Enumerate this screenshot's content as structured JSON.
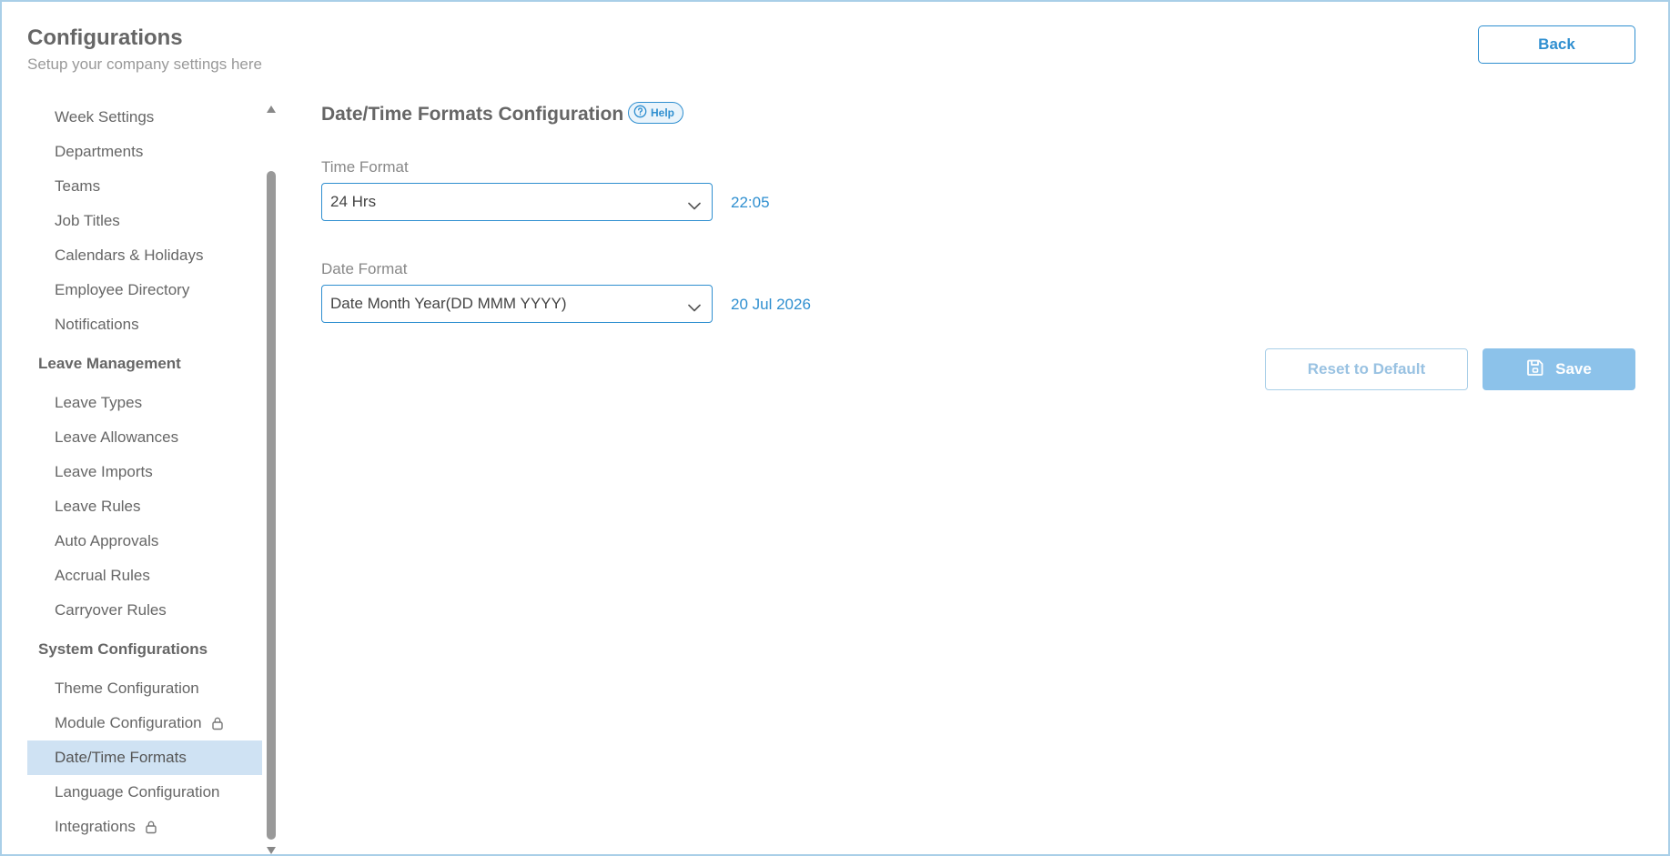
{
  "header": {
    "title": "Configurations",
    "subtitle": "Setup your company settings here",
    "back_label": "Back"
  },
  "sidebar": {
    "groups": [
      {
        "heading": "",
        "items": [
          {
            "label": "Week Settings",
            "locked": false,
            "active": false
          },
          {
            "label": "Departments",
            "locked": false,
            "active": false
          },
          {
            "label": "Teams",
            "locked": false,
            "active": false
          },
          {
            "label": "Job Titles",
            "locked": false,
            "active": false
          },
          {
            "label": "Calendars & Holidays",
            "locked": false,
            "active": false
          },
          {
            "label": "Employee Directory",
            "locked": false,
            "active": false
          },
          {
            "label": "Notifications",
            "locked": false,
            "active": false
          }
        ]
      },
      {
        "heading": "Leave Management",
        "items": [
          {
            "label": "Leave Types",
            "locked": false,
            "active": false
          },
          {
            "label": "Leave Allowances",
            "locked": false,
            "active": false
          },
          {
            "label": "Leave Imports",
            "locked": false,
            "active": false
          },
          {
            "label": "Leave Rules",
            "locked": false,
            "active": false
          },
          {
            "label": "Auto Approvals",
            "locked": false,
            "active": false
          },
          {
            "label": "Accrual Rules",
            "locked": false,
            "active": false
          },
          {
            "label": "Carryover Rules",
            "locked": false,
            "active": false
          }
        ]
      },
      {
        "heading": "System Configurations",
        "items": [
          {
            "label": "Theme Configuration",
            "locked": false,
            "active": false
          },
          {
            "label": "Module Configuration",
            "locked": true,
            "active": false
          },
          {
            "label": "Date/Time Formats",
            "locked": false,
            "active": true
          },
          {
            "label": "Language Configuration",
            "locked": false,
            "active": false
          },
          {
            "label": "Integrations",
            "locked": true,
            "active": false
          }
        ]
      }
    ]
  },
  "main": {
    "title": "Date/Time Formats Configuration",
    "help_label": "Help",
    "time_format": {
      "label": "Time Format",
      "value": "24 Hrs",
      "preview": "22:05"
    },
    "date_format": {
      "label": "Date Format",
      "value": "Date Month Year(DD MMM YYYY)",
      "preview": "20 Jul 2026"
    },
    "reset_label": "Reset to Default",
    "save_label": "Save"
  },
  "colors": {
    "accent": "#2f8fd0",
    "active_item_bg": "#cfe2f3",
    "save_bg": "#8cc2ea",
    "frame_border": "#a9cfe8"
  }
}
